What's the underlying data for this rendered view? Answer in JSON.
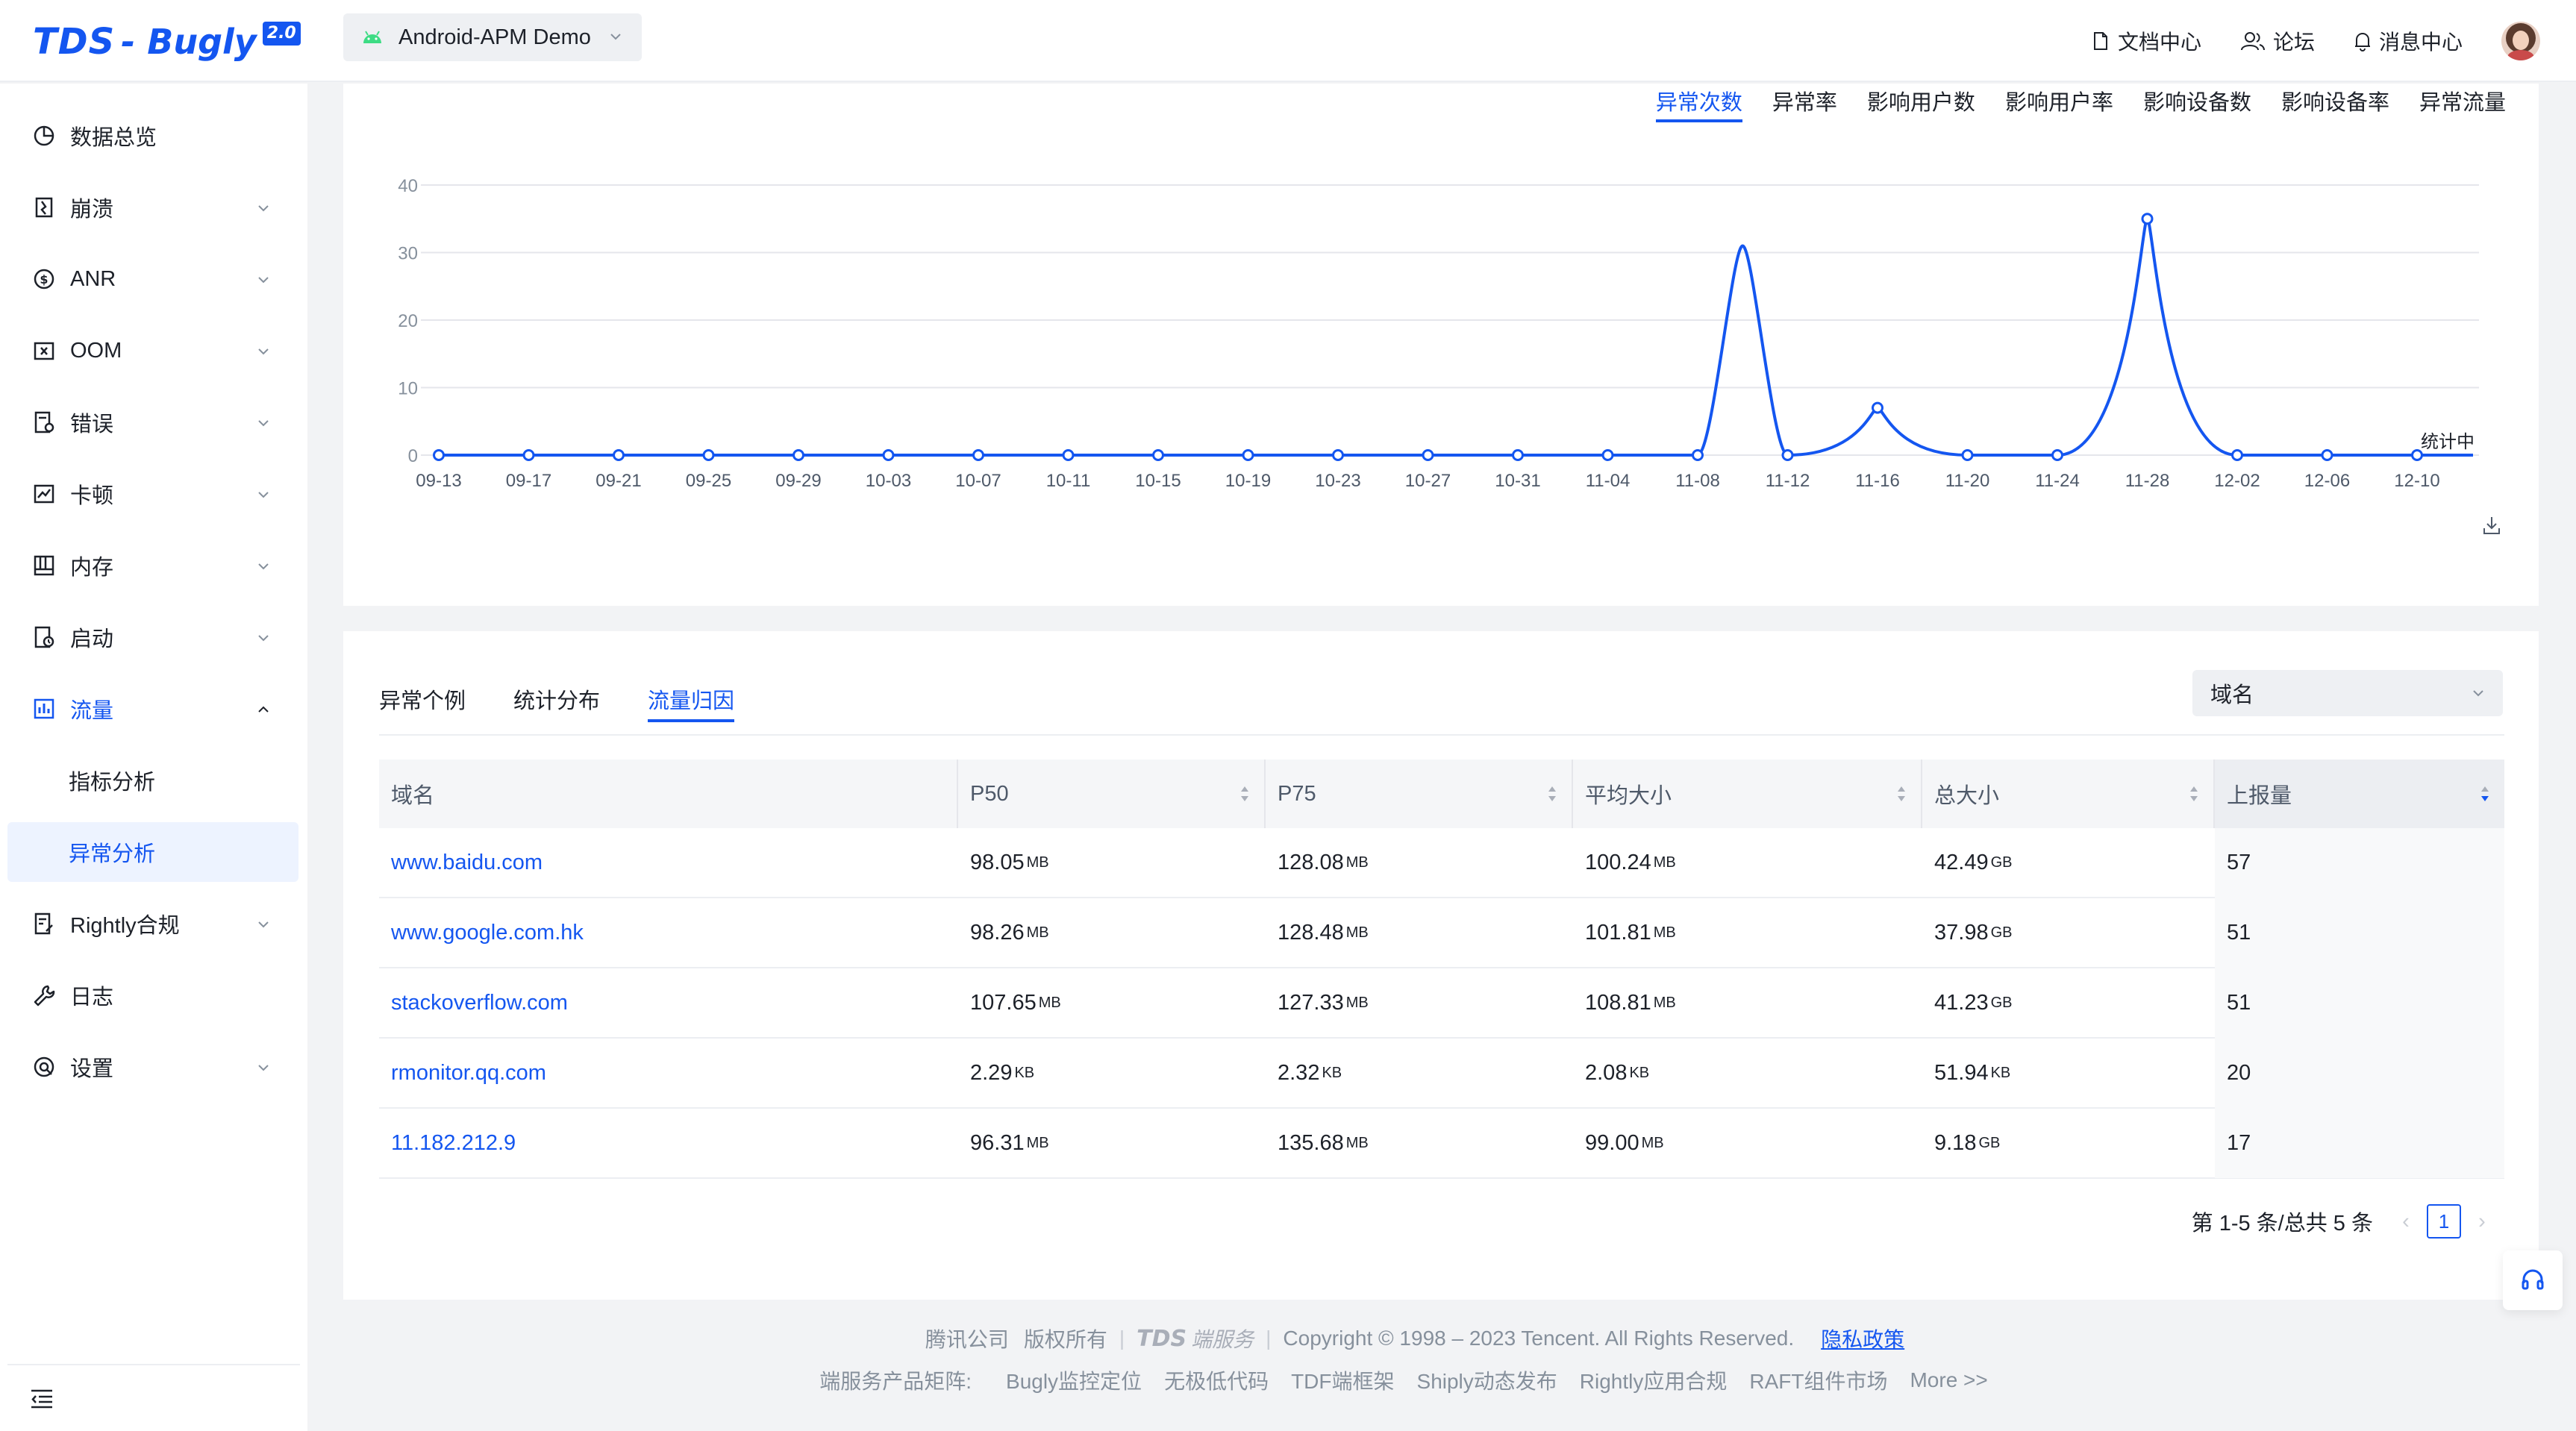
{
  "header": {
    "logo_main": "TDS",
    "logo_sub": "- Bugly",
    "logo_version": "2.0",
    "app_name": "Android-APM Demo",
    "links": [
      "文档中心",
      "论坛",
      "消息中心"
    ]
  },
  "sidebar": {
    "items": [
      {
        "label": "数据总览",
        "icon": "pie-chart-icon",
        "expandable": false
      },
      {
        "label": "崩溃",
        "icon": "crash-icon",
        "expandable": true
      },
      {
        "label": "ANR",
        "icon": "anr-icon",
        "expandable": true
      },
      {
        "label": "OOM",
        "icon": "oom-icon",
        "expandable": true
      },
      {
        "label": "错误",
        "icon": "error-icon",
        "expandable": true
      },
      {
        "label": "卡顿",
        "icon": "lag-icon",
        "expandable": true
      },
      {
        "label": "内存",
        "icon": "memory-icon",
        "expandable": true
      },
      {
        "label": "启动",
        "icon": "launch-icon",
        "expandable": true
      },
      {
        "label": "流量",
        "icon": "traffic-icon",
        "expandable": true,
        "expanded": true
      },
      {
        "label": "Rightly合规",
        "icon": "compliance-icon",
        "expandable": true
      },
      {
        "label": "日志",
        "icon": "log-icon",
        "expandable": false
      },
      {
        "label": "设置",
        "icon": "settings-icon",
        "expandable": true
      }
    ],
    "sub_items": [
      "指标分析",
      "异常分析"
    ]
  },
  "metric_tabs": [
    "异常次数",
    "异常率",
    "影响用户数",
    "影响用户率",
    "影响设备数",
    "影响设备率",
    "异常流量"
  ],
  "chart_data": {
    "type": "line",
    "x": [
      "09-13",
      "09-17",
      "09-21",
      "09-25",
      "09-29",
      "10-03",
      "10-07",
      "10-11",
      "10-15",
      "10-19",
      "10-23",
      "10-27",
      "10-31",
      "11-04",
      "11-08",
      "11-12",
      "11-16",
      "11-20",
      "11-24",
      "11-28",
      "12-02",
      "12-06",
      "12-10"
    ],
    "values": [
      0,
      0,
      0,
      0,
      0,
      0,
      0,
      0,
      0,
      0,
      0,
      0,
      0,
      0,
      0,
      0,
      7,
      0,
      0,
      35,
      0,
      0,
      0
    ],
    "peaks": [
      {
        "x": "11-10",
        "y": 31
      }
    ],
    "ylim": [
      0,
      40
    ],
    "yticks": [
      0,
      10,
      20,
      30,
      40
    ],
    "annotation": "统计中",
    "color": "#1456f0",
    "grid": true
  },
  "table_section": {
    "tabs": [
      "异常个例",
      "统计分布",
      "流量归因"
    ],
    "dimension": "域名",
    "columns": [
      "域名",
      "P50",
      "P75",
      "平均大小",
      "总大小",
      "上报量"
    ],
    "rows": [
      {
        "domain": "www.baidu.com",
        "p50": "98.05",
        "p50u": "MB",
        "p75": "128.08",
        "p75u": "MB",
        "avg": "100.24",
        "avgu": "MB",
        "total": "42.49",
        "totalu": "GB",
        "count": "57"
      },
      {
        "domain": "www.google.com.hk",
        "p50": "98.26",
        "p50u": "MB",
        "p75": "128.48",
        "p75u": "MB",
        "avg": "101.81",
        "avgu": "MB",
        "total": "37.98",
        "totalu": "GB",
        "count": "51"
      },
      {
        "domain": "stackoverflow.com",
        "p50": "107.65",
        "p50u": "MB",
        "p75": "127.33",
        "p75u": "MB",
        "avg": "108.81",
        "avgu": "MB",
        "total": "41.23",
        "totalu": "GB",
        "count": "51"
      },
      {
        "domain": "rmonitor.qq.com",
        "p50": "2.29",
        "p50u": "KB",
        "p75": "2.32",
        "p75u": "KB",
        "avg": "2.08",
        "avgu": "KB",
        "total": "51.94",
        "totalu": "KB",
        "count": "20"
      },
      {
        "domain": "11.182.212.9",
        "p50": "96.31",
        "p50u": "MB",
        "p75": "135.68",
        "p75u": "MB",
        "avg": "99.00",
        "avgu": "MB",
        "total": "9.18",
        "totalu": "GB",
        "count": "17"
      }
    ],
    "pagination_text": "第 1-5 条/总共 5 条",
    "current_page": "1"
  },
  "footer": {
    "company": "腾讯公司",
    "rights": "版权所有",
    "brand": "TDS",
    "brand_sub": "端服务",
    "copyright": "Copyright © 1998 – 2023 Tencent. All Rights Reserved.",
    "privacy": "隐私政策",
    "matrix_label": "端服务产品矩阵:",
    "products": [
      "Bugly监控定位",
      "无极低代码",
      "TDF端框架",
      "Shiply动态发布",
      "Rightly应用合规",
      "RAFT组件市场",
      "More >>"
    ]
  }
}
